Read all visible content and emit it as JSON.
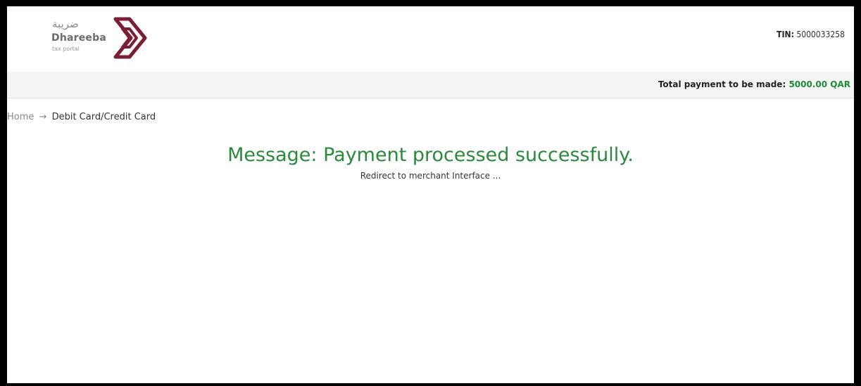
{
  "header": {
    "logo_arabic": "ضريبة",
    "logo_name": "Dhareeba",
    "logo_subtitle": "tax portal",
    "brand_color": "#7a1f33",
    "tin_label": "TIN:",
    "tin_value": "5000033258"
  },
  "payment": {
    "label": "Total payment to be made:",
    "amount": "5000.00 QAR",
    "amount_color": "#1c8c34"
  },
  "breadcrumb": {
    "home": "Home",
    "separator_icon": "arrow-right-icon",
    "current": "Debit Card/Credit Card"
  },
  "status": {
    "message": "Message: Payment processed successfully.",
    "redirect": "Redirect to merchant Interface ...",
    "message_color": "#2a8a3a"
  }
}
